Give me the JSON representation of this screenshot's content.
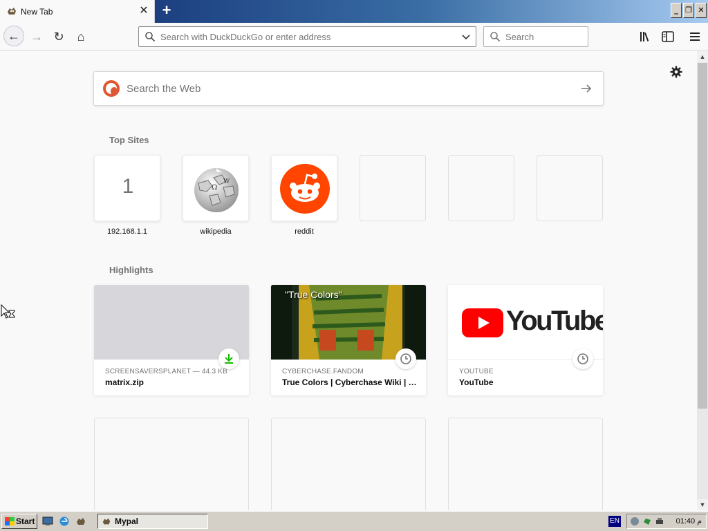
{
  "tab": {
    "title": "New Tab",
    "close_glyph": "✕"
  },
  "newtab": {
    "glyph": "+"
  },
  "window": {
    "min": "_",
    "restore": "❐",
    "close": "✕"
  },
  "nav": {
    "back": "←",
    "forward": "→",
    "reload": "↻",
    "home": "⌂"
  },
  "urlbar": {
    "placeholder": "Search with DuckDuckGo or enter address"
  },
  "searchbar": {
    "placeholder": "Search"
  },
  "websearch": {
    "placeholder": "Search the Web"
  },
  "sections": {
    "top_sites": "Top Sites",
    "highlights": "Highlights"
  },
  "top_sites": [
    {
      "label": "192.168.1.1",
      "letter": "1"
    },
    {
      "label": "wikipedia",
      "icon": "wikipedia-globe-icon"
    },
    {
      "label": "reddit",
      "icon": "reddit-alien-icon"
    }
  ],
  "highlights": [
    {
      "source": "SCREENSAVERSPLANET — 44.3 KB",
      "title": "matrix.zip",
      "badge": "download-icon"
    },
    {
      "source": "CYBERCHASE.FANDOM",
      "title": "True Colors | Cyberchase Wiki | Fandom",
      "thumb_caption": "\"True Colors\"",
      "badge": "clock-icon"
    },
    {
      "source": "YOUTUBE",
      "title": "YouTube",
      "thumb_logo": "YouTube",
      "badge": "clock-icon"
    }
  ],
  "taskbar": {
    "start": "Start",
    "task": "Mypal",
    "lang": "EN",
    "clock": "01:40 م"
  },
  "colors": {
    "accent": "#0060df",
    "reddit": "#ff4500",
    "youtube_red": "#ff0000",
    "download_green": "#12bc00"
  }
}
